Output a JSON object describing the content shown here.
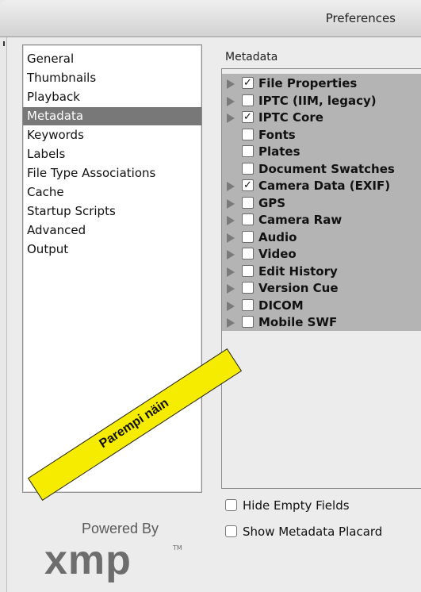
{
  "window": {
    "title": "Preferences"
  },
  "categories": [
    {
      "label": "General",
      "selected": false
    },
    {
      "label": "Thumbnails",
      "selected": false
    },
    {
      "label": "Playback",
      "selected": false
    },
    {
      "label": "Metadata",
      "selected": true
    },
    {
      "label": "Keywords",
      "selected": false
    },
    {
      "label": "Labels",
      "selected": false
    },
    {
      "label": "File Type Associations",
      "selected": false
    },
    {
      "label": "Cache",
      "selected": false
    },
    {
      "label": "Startup Scripts",
      "selected": false
    },
    {
      "label": "Advanced",
      "selected": false
    },
    {
      "label": "Output",
      "selected": false
    }
  ],
  "metadata": {
    "heading": "Metadata",
    "items": [
      {
        "label": "File Properties",
        "checked": true,
        "expandable": true
      },
      {
        "label": "IPTC (IIM, legacy)",
        "checked": false,
        "expandable": true
      },
      {
        "label": "IPTC Core",
        "checked": true,
        "expandable": true
      },
      {
        "label": "Fonts",
        "checked": false,
        "expandable": false
      },
      {
        "label": "Plates",
        "checked": false,
        "expandable": false
      },
      {
        "label": "Document Swatches",
        "checked": false,
        "expandable": false
      },
      {
        "label": "Camera Data (EXIF)",
        "checked": true,
        "expandable": true
      },
      {
        "label": "GPS",
        "checked": false,
        "expandable": true
      },
      {
        "label": "Camera Raw",
        "checked": false,
        "expandable": true
      },
      {
        "label": "Audio",
        "checked": false,
        "expandable": true
      },
      {
        "label": "Video",
        "checked": false,
        "expandable": true
      },
      {
        "label": "Edit History",
        "checked": false,
        "expandable": true
      },
      {
        "label": "Version Cue",
        "checked": false,
        "expandable": true
      },
      {
        "label": "DICOM",
        "checked": false,
        "expandable": true
      },
      {
        "label": "Mobile SWF",
        "checked": false,
        "expandable": true
      }
    ]
  },
  "options": {
    "hide_empty_fields": "Hide Empty Fields",
    "show_placard": "Show Metadata Placard"
  },
  "branding": {
    "powered_by": "Powered By",
    "logo_text": "xmp",
    "trademark": "TM"
  },
  "annotation": {
    "text": "Parempi näin",
    "color": "#f6ec00"
  },
  "icons": {
    "expand": "disclosure-triangle-icon",
    "check": "✓"
  }
}
